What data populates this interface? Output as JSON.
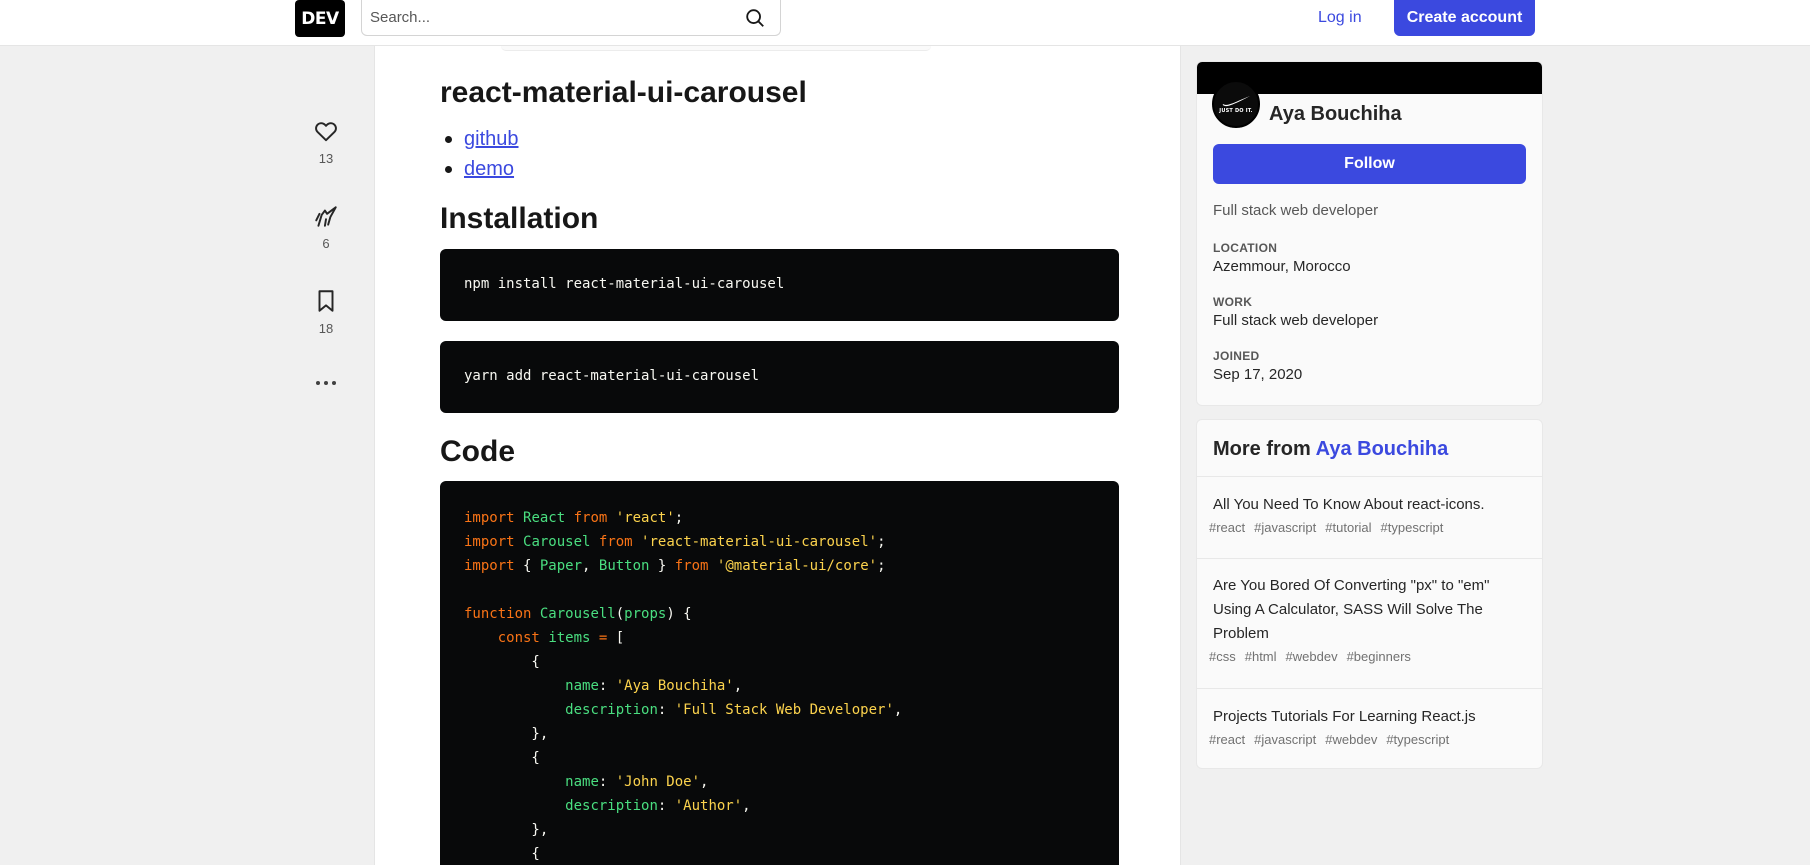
{
  "header": {
    "logo": "DEV",
    "search_placeholder": "Search...",
    "login_label": "Log in",
    "create_account_label": "Create account"
  },
  "actions": {
    "likes_count": "13",
    "unicorns_count": "6",
    "bookmarks_count": "18"
  },
  "article": {
    "title": "react-material-ui-carousel",
    "links": [
      "github",
      "demo"
    ],
    "installation_heading": "Installation",
    "npm_command": "npm install react-material-ui-carousel",
    "yarn_command": "yarn add react-material-ui-carousel",
    "code_heading": "Code"
  },
  "profile": {
    "avatar_text": "JUST DO IT.",
    "name": "Aya Bouchiha",
    "follow_label": "Follow",
    "bio": "Full stack web developer",
    "location_label": "LOCATION",
    "location": "Azemmour, Morocco",
    "work_label": "WORK",
    "work": "Full stack web developer",
    "joined_label": "JOINED",
    "joined": "Sep 17, 2020"
  },
  "more_from": {
    "prefix": "More from",
    "author": "Aya Bouchiha",
    "items": [
      {
        "title": "All You Need To Know About react-icons.",
        "tags": [
          "#react",
          "#javascript",
          "#tutorial",
          "#typescript"
        ]
      },
      {
        "title": "Are You Bored Of Converting \"px\" to \"em\" Using A Calculator, SASS Will Solve The Problem",
        "tags": [
          "#css",
          "#html",
          "#webdev",
          "#beginners"
        ]
      },
      {
        "title": "Projects Tutorials For Learning React.js",
        "tags": [
          "#react",
          "#javascript",
          "#webdev",
          "#typescript"
        ]
      }
    ]
  }
}
